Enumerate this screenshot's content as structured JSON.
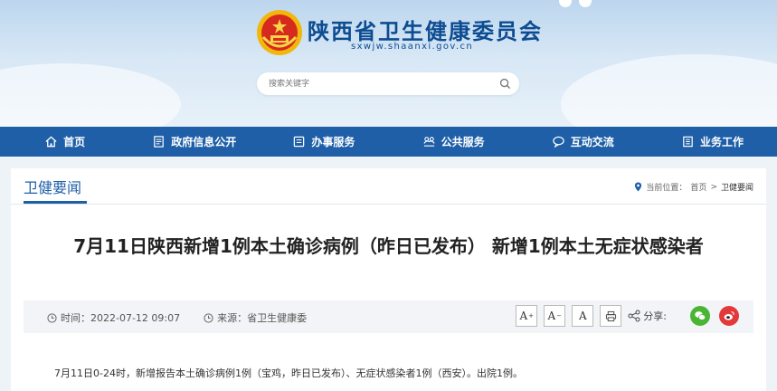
{
  "header": {
    "site_name": "陕西省卫生健康委员会",
    "site_url": "sxwjw.shaanxi.gov.cn",
    "search_placeholder": "搜索关键字"
  },
  "nav": {
    "items": [
      {
        "label": "首页",
        "icon": "home-icon"
      },
      {
        "label": "政府信息公开",
        "icon": "document-icon"
      },
      {
        "label": "办事服务",
        "icon": "form-icon"
      },
      {
        "label": "公共服务",
        "icon": "service-icon"
      },
      {
        "label": "互动交流",
        "icon": "chat-icon"
      },
      {
        "label": "业务工作",
        "icon": "building-icon"
      }
    ]
  },
  "section": {
    "title": "卫健要闻",
    "breadcrumb": {
      "prefix": "当前位置：",
      "home": "首页",
      "separator": ">",
      "current": "卫健要闻"
    }
  },
  "article": {
    "title": "7月11日陕西新增1例本土确诊病例（昨日已发布） 新增1例本土无症状感染者",
    "time_label": "时间：",
    "time_value": "2022-07-12 09:07",
    "source_label": "来源：",
    "source_value": "省卫生健康委",
    "font_increase": "A",
    "font_decrease": "A",
    "font_reset": "A",
    "share_label": "分享:",
    "body": "7月11日0-24时，新增报告本土确诊病例1例（宝鸡，昨日已发布）、无症状感染者1例（西安）。出院1例。"
  },
  "colors": {
    "primary": "#1e5fa8",
    "site_name": "#0d4c91",
    "wechat": "#4ab535",
    "weibo": "#e23a3a"
  }
}
